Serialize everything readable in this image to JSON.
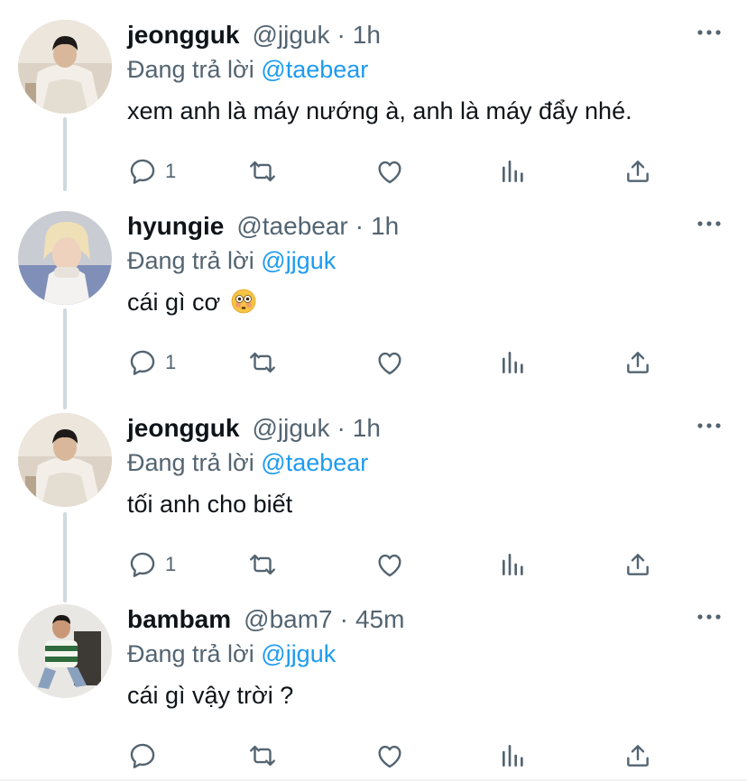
{
  "colors": {
    "accent": "#1d9bf0",
    "muted": "#536471",
    "text": "#0f1419",
    "thread_line": "#cfd9de"
  },
  "reply_prefix": "Đang trả lời",
  "tweets": [
    {
      "name": "jeongguk",
      "handle": "@jjguk",
      "dot": "·",
      "time": "1h",
      "reply_to": "@taebear",
      "text": "xem anh là máy nướng à, anh là máy đẩy nhé.",
      "reply_count": "1",
      "icons": [
        "reply-icon",
        "retweet-icon",
        "like-icon",
        "stats-icon",
        "share-icon",
        "more-icon"
      ]
    },
    {
      "name": "hyungie",
      "handle": "@taebear",
      "dot": "·",
      "time": "1h",
      "reply_to": "@jjguk",
      "text": "cái gì cơ",
      "emoji": "flushed-face-emoji",
      "reply_count": "1"
    },
    {
      "name": "jeongguk",
      "handle": "@jjguk",
      "dot": "·",
      "time": "1h",
      "reply_to": "@taebear",
      "text": "tối anh cho biết",
      "reply_count": "1"
    },
    {
      "name": "bambam",
      "handle": "@bam7",
      "dot": "·",
      "time": "45m",
      "reply_to": "@jjguk",
      "text": "cái gì vậy trời ?",
      "reply_count": ""
    }
  ]
}
